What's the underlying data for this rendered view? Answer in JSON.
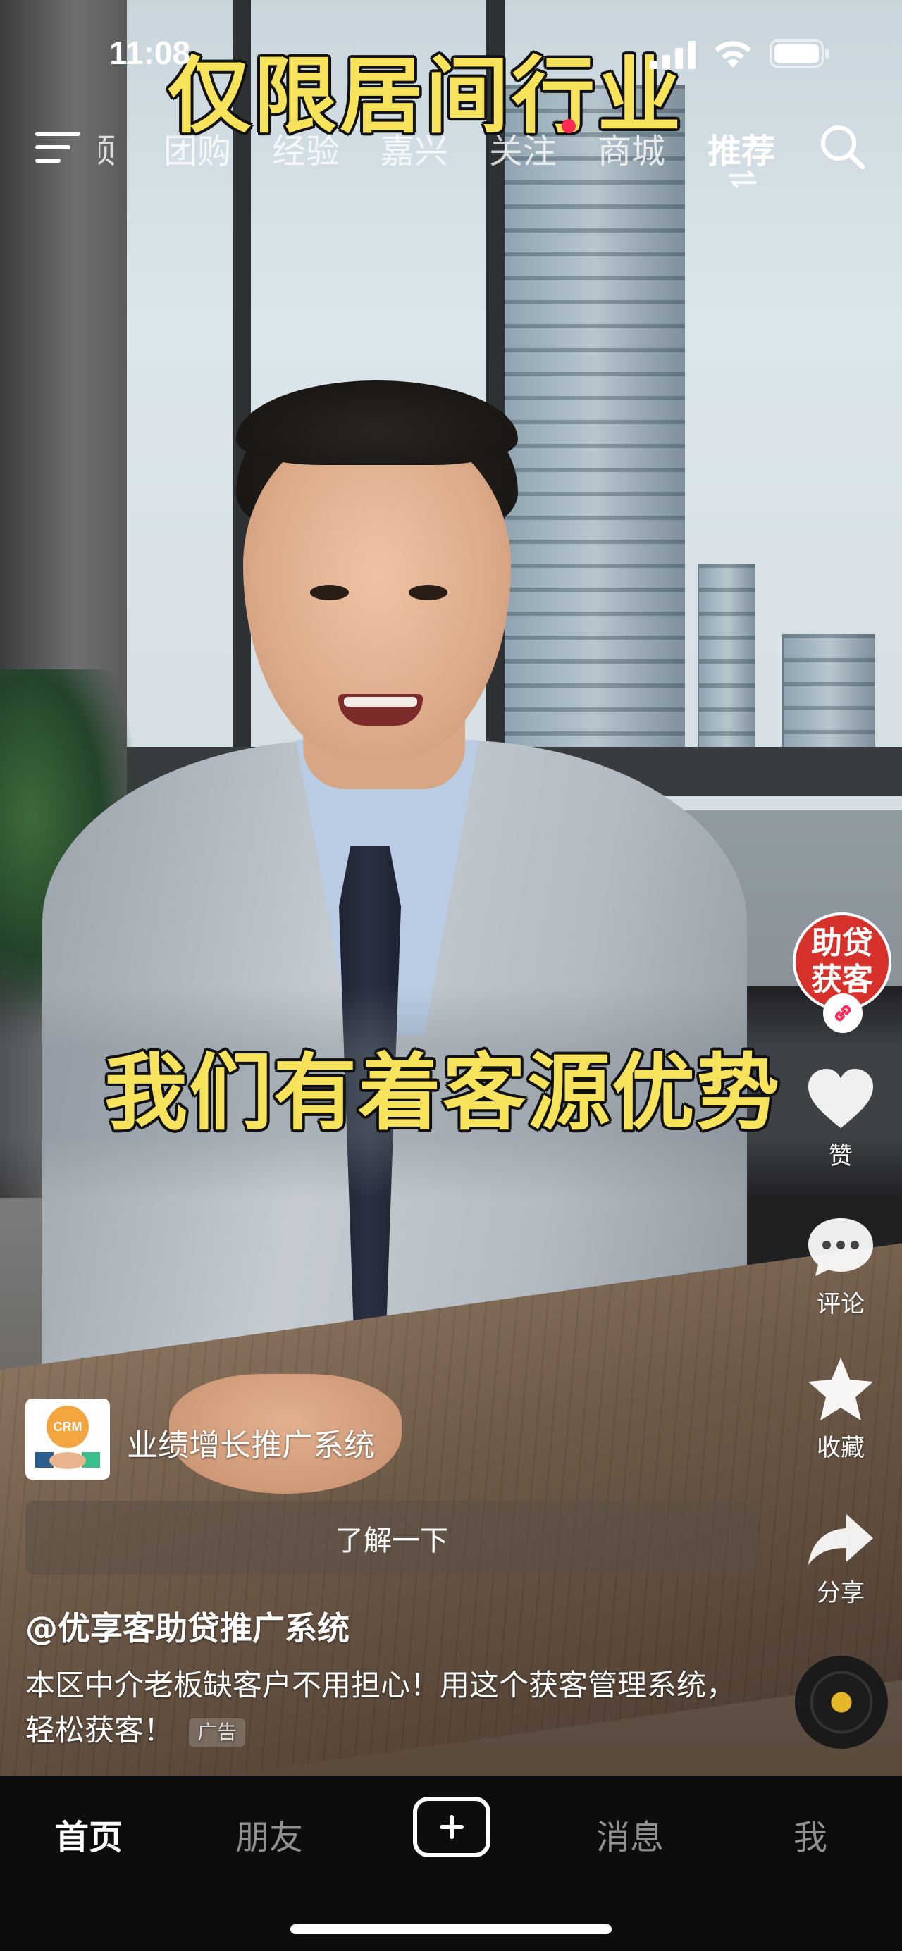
{
  "status_bar": {
    "time": "11:08"
  },
  "video_captions": {
    "top": "仅限居间行业",
    "middle": "我们有着客源优势"
  },
  "top_nav": {
    "tabs": [
      {
        "label": "顶"
      },
      {
        "label": "团购"
      },
      {
        "label": "经验"
      },
      {
        "label": "嘉兴"
      },
      {
        "label": "关注"
      },
      {
        "label": "商城"
      },
      {
        "label": "推荐"
      }
    ],
    "active_tab": "推荐"
  },
  "right_rail": {
    "avatar_text": "助贷获客",
    "like_label": "赞",
    "comment_label": "评论",
    "favorite_label": "收藏",
    "share_label": "分享"
  },
  "ad_card": {
    "logo_text": "CRM",
    "title": "业绩增长推广系统",
    "button_label": "了解一下"
  },
  "post": {
    "author": "@优享客助贷推广系统",
    "description": "本区中介老板缺客户不用担心！用这个获客管理系统，轻松获客！",
    "ad_tag": "广告"
  },
  "bottom_tabs": {
    "home": "首页",
    "friends": "朋友",
    "messages": "消息",
    "me": "我"
  },
  "colors": {
    "caption_yellow": "#f7e25b",
    "notification_red": "#fe2c55",
    "avatar_red": "#d6322b"
  }
}
